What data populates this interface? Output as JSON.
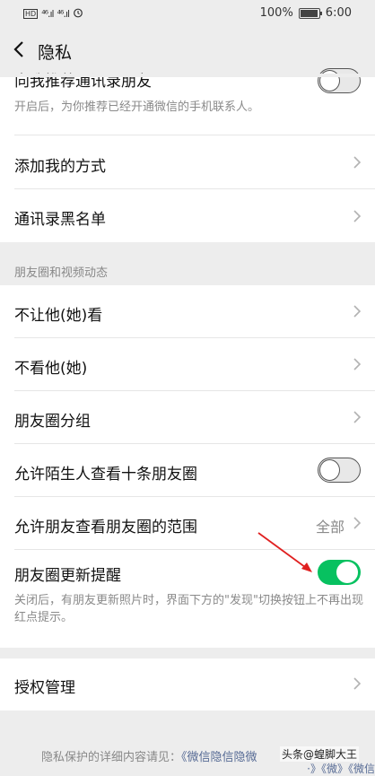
{
  "status_bar": {
    "left_signal_1": "⁴⁶.ıl",
    "left_signal_2": "⁴⁶.ıl",
    "hd": "HD",
    "battery_percent": "100%",
    "time": "6:00"
  },
  "header": {
    "title": "隐私"
  },
  "rows": {
    "recommend_contacts": {
      "label": "向我推荐通讯录朋友",
      "desc": "开启后，为你推荐已经开通微信的手机联系人。",
      "toggle": "off"
    },
    "add_me_methods": {
      "label": "添加我的方式"
    },
    "contacts_blacklist": {
      "label": "通讯录黑名单"
    },
    "moments_section": {
      "label": "朋友圈和视频动态"
    },
    "hide_my_posts": {
      "label": "不让他(她)看"
    },
    "hide_their_posts": {
      "label": "不看他(她)"
    },
    "moments_groups": {
      "label": "朋友圈分组"
    },
    "stranger_ten_posts": {
      "label": "允许陌生人查看十条朋友圈",
      "toggle": "off"
    },
    "friends_view_range": {
      "label": "允许朋友查看朋友圈的范围",
      "value": "全部"
    },
    "moments_update_reminder": {
      "label": "朋友圈更新提醒",
      "desc": "关闭后，有朋友更新照片时，界面下方的\"发现\"切换按钮上不再出现红点提示。",
      "toggle": "on"
    },
    "authorization_management": {
      "label": "授权管理"
    }
  },
  "footer": {
    "prefix": "隐私保护的详细内容请见：",
    "link": "《微信隐信隐微",
    "fragment": "·》《微》《微信"
  },
  "watermark": "头条@蝗脚大王",
  "colors": {
    "accent_green": "#07c160",
    "link_blue": "#576b95",
    "annotation_red": "#e02020"
  }
}
